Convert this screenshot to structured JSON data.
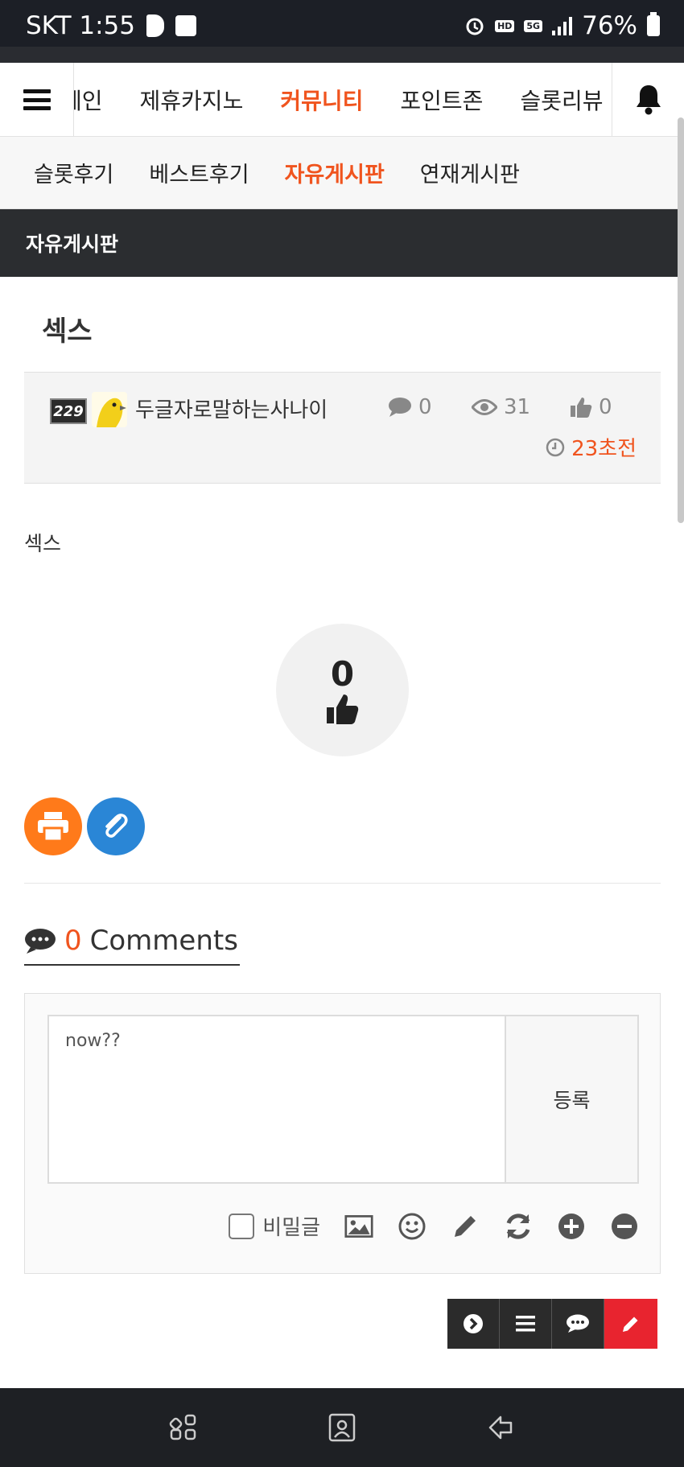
{
  "status_bar": {
    "carrier_time": "SKT 1:55",
    "battery": "76%",
    "network": "5G",
    "hd_voice": "HD"
  },
  "top_nav": {
    "items": [
      "메인",
      "제휴카지노",
      "커뮤니티",
      "포인트존",
      "슬롯리뷰"
    ],
    "active": "커뮤니티"
  },
  "sub_nav": {
    "items": [
      "슬롯후기",
      "베스트후기",
      "자유게시판",
      "연재게시판"
    ],
    "active": "자유게시판"
  },
  "board": {
    "title": "자유게시판"
  },
  "post": {
    "title": "섹스",
    "level": "229",
    "author": "두글자로말하는사나이",
    "comments": "0",
    "views": "31",
    "likes": "0",
    "time": "23초전",
    "body": "섹스",
    "like_count": "0"
  },
  "comments": {
    "count": "0",
    "label": "Comments",
    "input_value": "now??",
    "submit_label": "등록",
    "secret_label": "비밀글"
  },
  "colors": {
    "accent": "#f0541e",
    "header_dark": "#2b2d30",
    "print_button": "#ff7a1a",
    "link_button": "#2a86d6",
    "write_button": "#e8242f"
  },
  "icons": {
    "tools": [
      "image-icon",
      "emoji-icon",
      "pencil-icon",
      "refresh-icon",
      "plus-circle-icon",
      "minus-circle-icon"
    ],
    "actions": [
      "next-icon",
      "list-icon",
      "comment-icon",
      "write-icon"
    ],
    "bottom_nav": [
      "recent-apps-icon",
      "home-icon",
      "back-icon"
    ]
  }
}
